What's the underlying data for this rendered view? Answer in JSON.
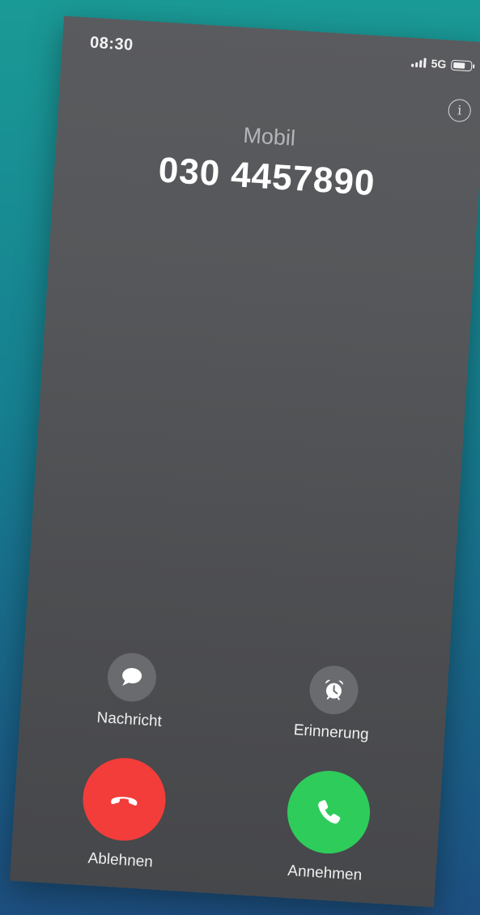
{
  "status_bar": {
    "time": "08:30",
    "network": "5G",
    "signal_icon": "signal-bars-icon",
    "battery_icon": "battery-icon"
  },
  "info_button": {
    "icon": "info-icon",
    "glyph": "i"
  },
  "caller": {
    "label": "Mobil",
    "number": "030 4457890"
  },
  "actions": {
    "message": {
      "label": "Nachricht",
      "icon": "message-bubble-icon"
    },
    "reminder": {
      "label": "Erinnerung",
      "icon": "alarm-clock-icon"
    },
    "decline": {
      "label": "Ablehnen",
      "icon": "phone-hangup-icon",
      "color": "#f23d3a"
    },
    "accept": {
      "label": "Annehmen",
      "icon": "phone-icon",
      "color": "#2ecc5b"
    }
  },
  "colors": {
    "background_top": "#1a9a96",
    "background_bottom": "#1d4f80",
    "screen": "#55575a",
    "small_button": "#6a6b6e"
  }
}
